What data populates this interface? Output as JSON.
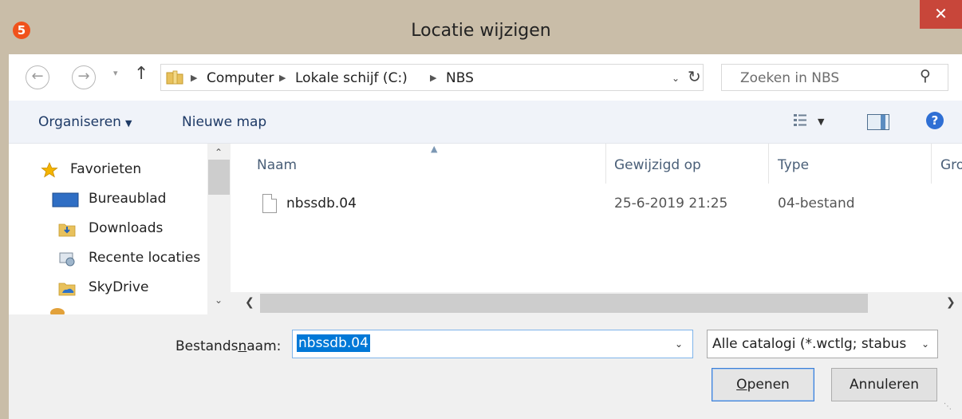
{
  "window": {
    "title": "Locatie wijzigen",
    "app_icon_glyph": "5",
    "close_glyph": "✕"
  },
  "address_bar": {
    "crumbs": [
      "Computer",
      "Lokale schijf (C:)",
      "NBS"
    ],
    "search_placeholder": "Zoeken in NBS"
  },
  "toolbar": {
    "organize_label": "Organiseren",
    "new_folder_label": "Nieuwe map",
    "help_glyph": "?"
  },
  "nav_pane": {
    "items": [
      {
        "label": "Favorieten",
        "icon": "star-icon"
      },
      {
        "label": "Bureaublad",
        "icon": "desktop-icon"
      },
      {
        "label": "Downloads",
        "icon": "downloads-folder-icon"
      },
      {
        "label": "Recente locaties",
        "icon": "recent-places-icon"
      },
      {
        "label": "SkyDrive",
        "icon": "skydrive-folder-icon"
      }
    ]
  },
  "file_list": {
    "columns": [
      "Naam",
      "Gewijzigd op",
      "Type",
      "Gro"
    ],
    "rows": [
      {
        "name": "nbssdb.04",
        "modified": "25-6-2019 21:25",
        "type": "04-bestand"
      }
    ]
  },
  "bottom": {
    "filename_label_pre": "Bestands",
    "filename_label_u": "n",
    "filename_label_post": "aam:",
    "filename_value": "nbssdb.04",
    "filter_value": "Alle catalogi (*.wctlg; stabus",
    "open_u": "O",
    "open_rest": "penen",
    "cancel_label": "Annuleren"
  },
  "colors": {
    "title_bg": "#c9bda8",
    "close_bg": "#c8463a",
    "selection": "#0078d7",
    "toolbar_bg": "#f0f3f9"
  }
}
